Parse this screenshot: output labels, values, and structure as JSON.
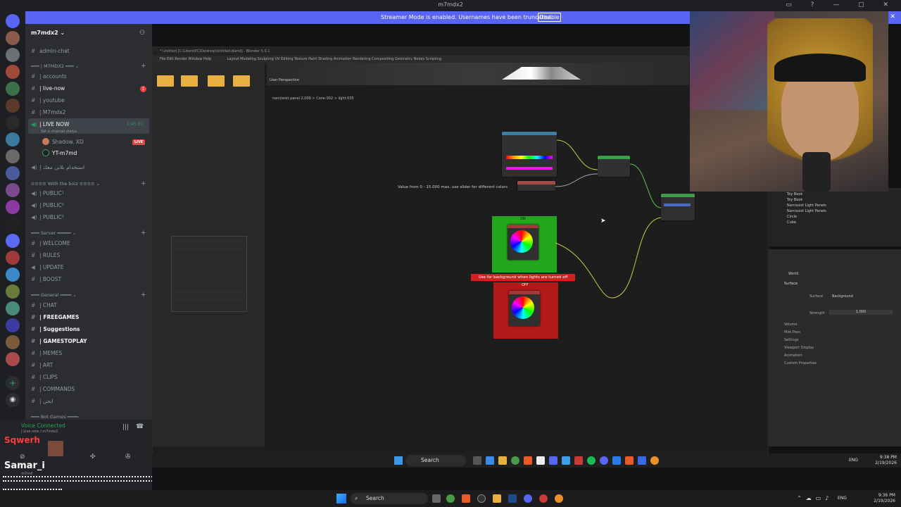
{
  "window": {
    "title": "m7mdx2"
  },
  "banner": {
    "message": "Streamer Mode is enabled. Usernames have been truncated.",
    "disable_label": "Disable"
  },
  "server": {
    "name": "m7mdx2"
  },
  "channels": {
    "admin_chat": "admin-chat",
    "cat_m7mdx2": "M7MDX2",
    "accounts": "| accounts",
    "live_now": "| live-now",
    "youtube": "| youtube",
    "m7mdx2": "| M7mdx2",
    "live_now_voice": "| LIVE NOW",
    "live_now_time": "1:45:37",
    "set_status": "Set a channel status",
    "voice_user1": "Shadow.",
    "voice_user1_tag": "XD",
    "live_tag": "LIVE",
    "voice_user2": "YT-m7md",
    "arabic_voice": "| استخدام بلابن معك",
    "cat_public": "With the boiz",
    "public1": "| PUBLIC¹",
    "public2": "| PUBLIC²",
    "public3": "| PUBLIC³",
    "cat_server": "Server",
    "welcome": "| WELCOME",
    "rules": "| RULES",
    "update": "| UPDATE",
    "boost": "| BOOST",
    "cat_general": "General",
    "chat": "| CHAT",
    "freegames": "| FREEGAMES",
    "suggestions": "| Suggestions",
    "gamestoplay": "| GAMESTOPLAY",
    "memes": "| MEMES",
    "art": "| ART",
    "clips": "| CLIPS",
    "commands": "| COMMANDS",
    "arabic_text": "| ايجن",
    "cat_bot": "Bot Games",
    "badge_count": "1"
  },
  "voice_panel": {
    "status": "Voice Connected",
    "channel": "| Live now / m7mdx2",
    "overlay_name1": "Sqwerh",
    "overlay_name2": "Samar_i",
    "overlay_sub": "m7md"
  },
  "blender": {
    "title": "* Untitled [C:\\Users\\PC\\Desktop\\Untitled.blend] - Blender 5.0.1",
    "workspaces": "Layout   Modeling   Sculpting   UV Editing   Texture Paint   Shading   Animation   Rendering   Compositing   Geometry Nodes   Scripting",
    "menus": "File   Edit   Render   Window   Help",
    "viewport_label": "User Perspective",
    "breadcrumb": "narcissist panel 2.009  >  Cone.002  >  light.035",
    "tooltip": "Value from 0 - 15.000 max, use slider for different colors",
    "frame_on_label": "ON",
    "frame_off_label": "OFF",
    "note": "Use for background when lights are turned off",
    "world_label": "World",
    "surface_label": "Surface",
    "surface_value": "Background",
    "strength_label": "Strength",
    "strength_value": "1.000",
    "sections": [
      "Volume",
      "Mist Pass",
      "Settings",
      "Viewport Display",
      "Animation",
      "Custom Properties"
    ],
    "outliner_items": [
      "Toy Book",
      "Toy Book",
      "Narcissist Light Panels",
      "Narcissist Light Panels",
      "Circle",
      "Cube"
    ]
  },
  "inner_taskbar": {
    "search": "Search",
    "lang": "ENG",
    "time": "9:38 PM",
    "date": "2/19/2026"
  },
  "taskbar": {
    "search": "Search",
    "lang": "ENG",
    "time": "9:36 PM",
    "date": "2/19/2026"
  },
  "colors": {
    "accent": "#5865f2",
    "live": "#ed4245",
    "green_frame": "#22a61c",
    "red_frame": "#b21a1a",
    "note_bg": "#d42020"
  }
}
